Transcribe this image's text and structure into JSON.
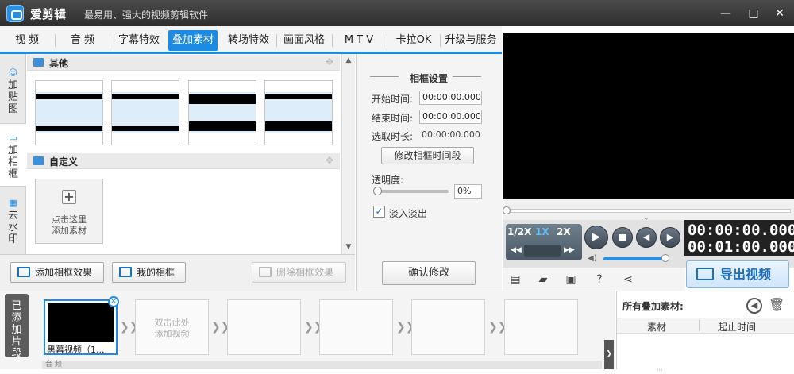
{
  "app": {
    "name": "爱剪辑",
    "slogan": "最易用、强大的视频剪辑软件"
  },
  "window": {
    "minimize": "—",
    "maximize": "□",
    "close": "✕"
  },
  "tabs": [
    "视 频",
    "音 频",
    "字幕特效",
    "叠加素材",
    "转场特效",
    "画面风格",
    "M T V",
    "卡拉OK",
    "升级与服务"
  ],
  "active_tab": "叠加素材",
  "side_tabs": [
    {
      "label": "加\n贴\n图",
      "icon": "sticker-icon"
    },
    {
      "label": "加\n相\n框",
      "icon": "frame-icon"
    },
    {
      "label": "去\n水\n印",
      "icon": "watermark-icon"
    }
  ],
  "sections": {
    "other": "其他",
    "custom": "自定义"
  },
  "custom_tile": "点击这里\n添加素材",
  "toolbar": {
    "add_effect": "添加相框效果",
    "my_frames": "我的相框",
    "delete_effect": "删除相框效果"
  },
  "settings": {
    "title": "相框设置",
    "start_label": "开始时间:",
    "start_value": "00:00:00.000",
    "end_label": "结束时间:",
    "end_value": "00:00:00.000",
    "duration_label": "选取时长:",
    "duration_value": "00:00:00.000",
    "edit_time_button": "修改相框时间段",
    "opacity_label": "透明度:",
    "opacity_value": "0%",
    "fade_label": "淡入淡出",
    "fade_checked": true,
    "confirm_button": "确认修改"
  },
  "player": {
    "speeds": [
      "1/2X",
      "1X",
      "2X"
    ],
    "selected_speed": "1X",
    "time_current": "00:00:00.000",
    "time_total": "00:01:00.000",
    "progress": 0,
    "volume": 0.95
  },
  "export_button": "导出视频",
  "timeline": {
    "added_tab": "已\n添\n加\n片\n段",
    "clip_name": "黑幕视频（1...",
    "empty_clip": "双击此处\n添加视频",
    "audio_label": "音 频"
  },
  "materials": {
    "title": "所有叠加素材:",
    "col_material": "素材",
    "col_time": "起止时间"
  }
}
